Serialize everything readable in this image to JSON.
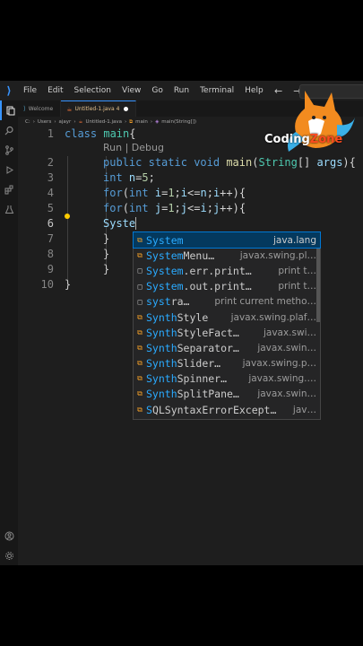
{
  "menu": [
    "File",
    "Edit",
    "Selection",
    "View",
    "Go",
    "Run",
    "Terminal",
    "Help"
  ],
  "nav": {
    "back": "←",
    "forward": "→"
  },
  "tabs": [
    {
      "label": "Welcome",
      "active": false
    },
    {
      "label": "Untitled-1.java 4",
      "active": true
    }
  ],
  "breadcrumb": [
    "C:",
    "Users",
    "ajayr",
    "Untitled-1.java",
    "main",
    "main(String[])"
  ],
  "codelens": "Run | Debug",
  "lines": [
    {
      "n": "1",
      "t": "class main{"
    },
    {
      "n": "2",
      "t": "public static void main(String[] args){"
    },
    {
      "n": "3",
      "t": "int n=5;"
    },
    {
      "n": "4",
      "t": "for(int i=1;i<=n;i++){"
    },
    {
      "n": "5",
      "t": "for(int j=1;j<=i;j++){"
    },
    {
      "n": "6",
      "t": "Syste"
    },
    {
      "n": "7",
      "t": "}"
    },
    {
      "n": "8",
      "t": "}"
    },
    {
      "n": "9",
      "t": "}"
    },
    {
      "n": "10",
      "t": "}"
    }
  ],
  "suggestions": [
    {
      "match": "System",
      "rest": "",
      "detail": "java.lang",
      "icon": "class-icon",
      "selected": true
    },
    {
      "match": "System",
      "rest": "Menu…",
      "detail": "javax.swing.pl…",
      "icon": "class-icon"
    },
    {
      "match": "System",
      "rest": ".err.print…",
      "detail": "print t…",
      "icon": "snippet-icon"
    },
    {
      "match": "System",
      "rest": ".out.print…",
      "detail": "print t…",
      "icon": "snippet-icon"
    },
    {
      "match": "syst",
      "rest": "ra…",
      "detail": "print current metho…",
      "icon": "snippet-icon"
    },
    {
      "match": "Synth",
      "rest": "Style",
      "detail": "javax.swing.plaf…",
      "icon": "class-icon"
    },
    {
      "match": "Synth",
      "rest": "StyleFact…",
      "detail": "javax.swi…",
      "icon": "class-icon"
    },
    {
      "match": "Synth",
      "rest": "Separator…",
      "detail": "javax.swin…",
      "icon": "class-icon"
    },
    {
      "match": "Synth",
      "rest": "Slider…",
      "detail": "javax.swing.p…",
      "icon": "class-icon"
    },
    {
      "match": "Synth",
      "rest": "Spinner…",
      "detail": "javax.swing.…",
      "icon": "class-icon"
    },
    {
      "match": "Synth",
      "rest": "SplitPane…",
      "detail": "javax.swin…",
      "icon": "class-icon"
    },
    {
      "match": "S",
      "rest": "QLSyntaxErrorExcept…",
      "detail": "jav…",
      "icon": "class-icon"
    }
  ],
  "watermark": {
    "part1": "Coding",
    "part2": "Zone"
  },
  "colors": {
    "accent": "#3794ff",
    "selection": "#04395e",
    "match": "#2aaaff"
  }
}
